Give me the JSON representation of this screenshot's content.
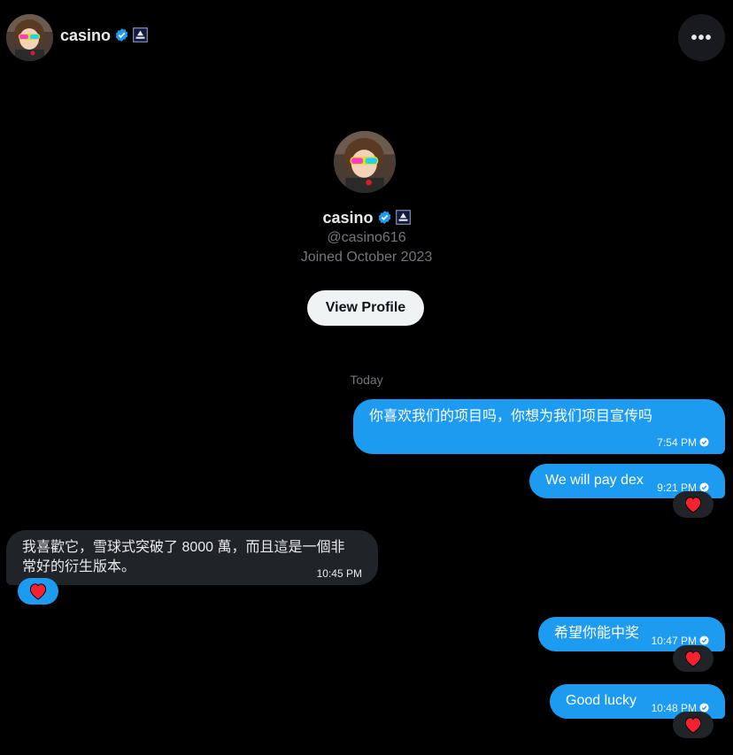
{
  "header": {
    "name": "casino",
    "verified_icon": "verified-badge-icon",
    "affiliate_icon": "affiliate-badge-icon",
    "more_icon": "more-horizontal-icon",
    "more_label": "•••"
  },
  "profile": {
    "name": "casino",
    "handle": "@casino616",
    "joined": "Joined October 2023",
    "view_profile_label": "View Profile"
  },
  "conversation": {
    "day_label": "Today",
    "messages": [
      {
        "direction": "sent",
        "text": "你喜欢我们的项目吗，你想为我们项目宣传吗",
        "time": "7:54 PM",
        "reaction": ""
      },
      {
        "direction": "sent",
        "text": "We will pay dex",
        "time": "9:21 PM",
        "reaction": "heart"
      },
      {
        "direction": "received",
        "text_line1": "我喜歡它，雪球式突破了 8000 萬，而且這是一個非",
        "text_line2": "常好的衍生版本。",
        "time": "10:45 PM",
        "reaction": "heart"
      },
      {
        "direction": "sent",
        "text": "希望你能中奖",
        "time": "10:47 PM",
        "reaction": "heart"
      },
      {
        "direction": "sent",
        "text": "Good lucky",
        "time": "10:48 PM",
        "reaction": "heart"
      }
    ]
  },
  "colors": {
    "background": "#000000",
    "sent_bubble": "#1d9bf0",
    "received_bubble": "#202327",
    "muted_text": "#71767b",
    "heart": "#f4212e"
  }
}
